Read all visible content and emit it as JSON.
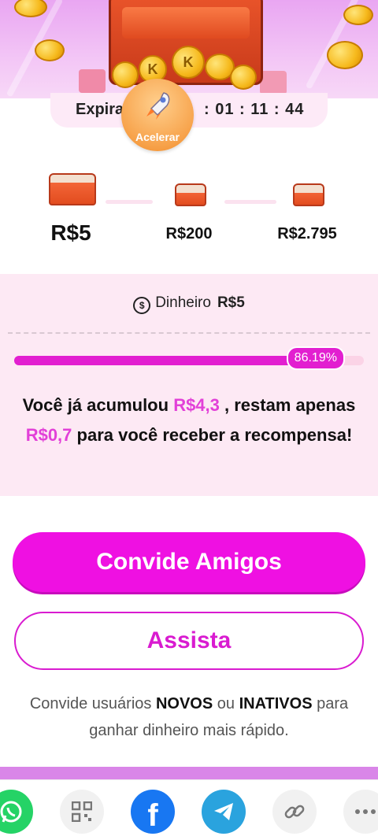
{
  "expire": {
    "label": "Expira",
    "time": ": 01 : 11 : 44"
  },
  "accelerate": {
    "label": "Acelerar"
  },
  "tiers": [
    {
      "amount": "R$5",
      "active": true
    },
    {
      "amount": "R$200",
      "active": false
    },
    {
      "amount": "R$2.795",
      "active": false
    }
  ],
  "card": {
    "currency_label": "Dinheiro",
    "currency_amount": "R$5",
    "progress_percent": 86.19,
    "progress_label": "86.19%",
    "message": {
      "part1": "Você já acumulou ",
      "accumulated": "R$4,3",
      "part2": " , restam apenas ",
      "remaining": "R$0,7",
      "part3": " para você receber a recompensa!"
    }
  },
  "buttons": {
    "invite": "Convide Amigos",
    "watch": "Assista"
  },
  "hint": {
    "part1": "Convide usuários ",
    "bold1": "NOVOS",
    "part2": " ou ",
    "bold2": "INATIVOS",
    "part3": " para ganhar dinheiro mais rápido."
  },
  "share_icons": [
    "whatsapp-icon",
    "qr-code-icon",
    "facebook-icon",
    "telegram-icon",
    "link-icon",
    "more-icon"
  ],
  "colors": {
    "accent": "#ef10e2",
    "highlight": "#e240d8",
    "whatsapp": "#25d366",
    "facebook": "#1877f2",
    "telegram": "#2aa3de"
  }
}
